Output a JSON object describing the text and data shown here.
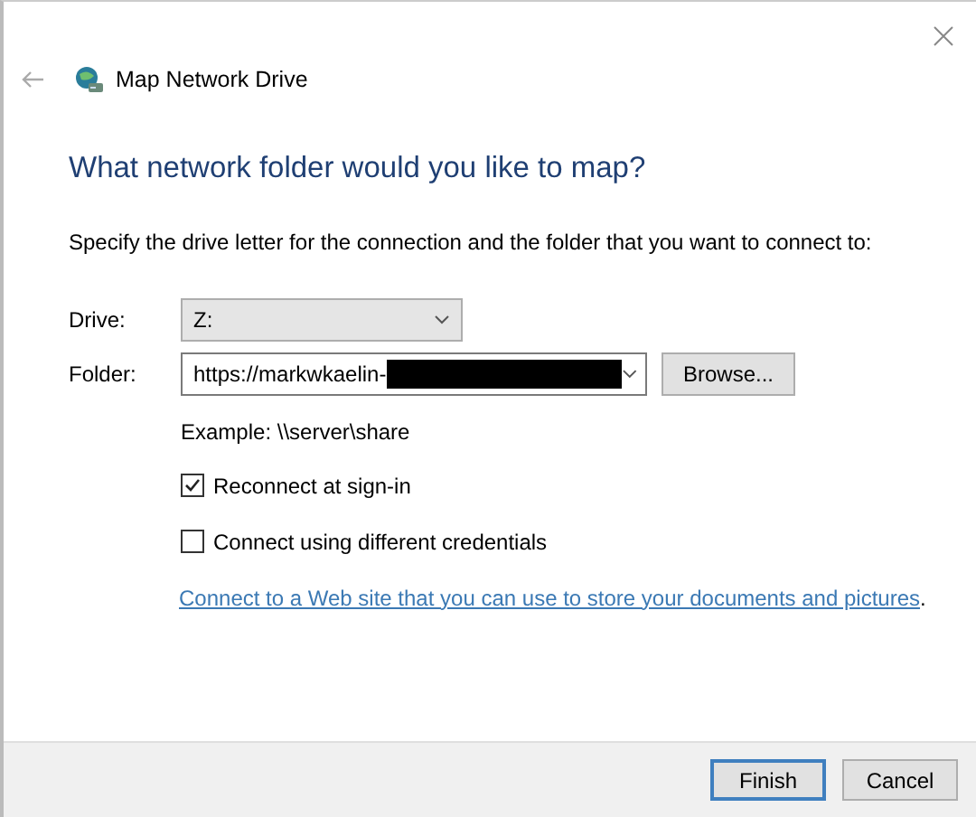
{
  "window": {
    "title": "Map Network Drive"
  },
  "heading": "What network folder would you like to map?",
  "instruction": "Specify the drive letter for the connection and the folder that you want to connect to:",
  "drive": {
    "label": "Drive:",
    "value": "Z:"
  },
  "folder": {
    "label": "Folder:",
    "value": "https://markwkaelin-",
    "redacted": true,
    "browse": "Browse..."
  },
  "example": "Example: \\\\server\\share",
  "options": [
    {
      "label": "Reconnect at sign-in",
      "checked": true
    },
    {
      "label": "Connect using different credentials",
      "checked": false
    }
  ],
  "link": {
    "text": "Connect to a Web site that you can use to store your documents and pictures",
    "after": "."
  },
  "buttons": [
    {
      "label": "Finish",
      "default": true
    },
    {
      "label": "Cancel",
      "default": false
    }
  ]
}
